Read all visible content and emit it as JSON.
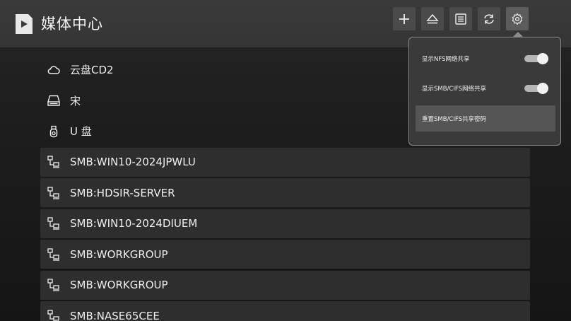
{
  "app": {
    "title": "媒体中心",
    "icon": "play-folder-icon"
  },
  "toolbar": {
    "buttons": [
      {
        "icon": "plus-icon"
      },
      {
        "icon": "eject-icon"
      },
      {
        "icon": "list-icon"
      },
      {
        "icon": "refresh-icon"
      },
      {
        "icon": "gear-icon",
        "active": true
      }
    ]
  },
  "list": {
    "items": [
      {
        "label": "云盘CD2",
        "icon": "cloud-icon"
      },
      {
        "label": "宋",
        "icon": "hard-drive-icon"
      },
      {
        "label": "U 盘",
        "icon": "usb-icon"
      },
      {
        "label": "SMB:WIN10-2024JPWLU",
        "icon": "network-icon"
      },
      {
        "label": "SMB:HDSIR-SERVER",
        "icon": "network-icon"
      },
      {
        "label": "SMB:WIN10-2024DIUEM",
        "icon": "network-icon"
      },
      {
        "label": "SMB:WORKGROUP",
        "icon": "network-icon"
      },
      {
        "label": "SMB:WORKGROUP",
        "icon": "network-icon"
      },
      {
        "label": "SMB:NASE65CEE",
        "icon": "network-icon"
      }
    ]
  },
  "settings_menu": {
    "options": [
      {
        "label": "显示NFS网络共享",
        "toggle": true
      },
      {
        "label": "显示SMB/CIFS网络共享",
        "toggle": true
      },
      {
        "label": "重置SMB/CIFS共享密码",
        "highlighted": true
      }
    ]
  }
}
